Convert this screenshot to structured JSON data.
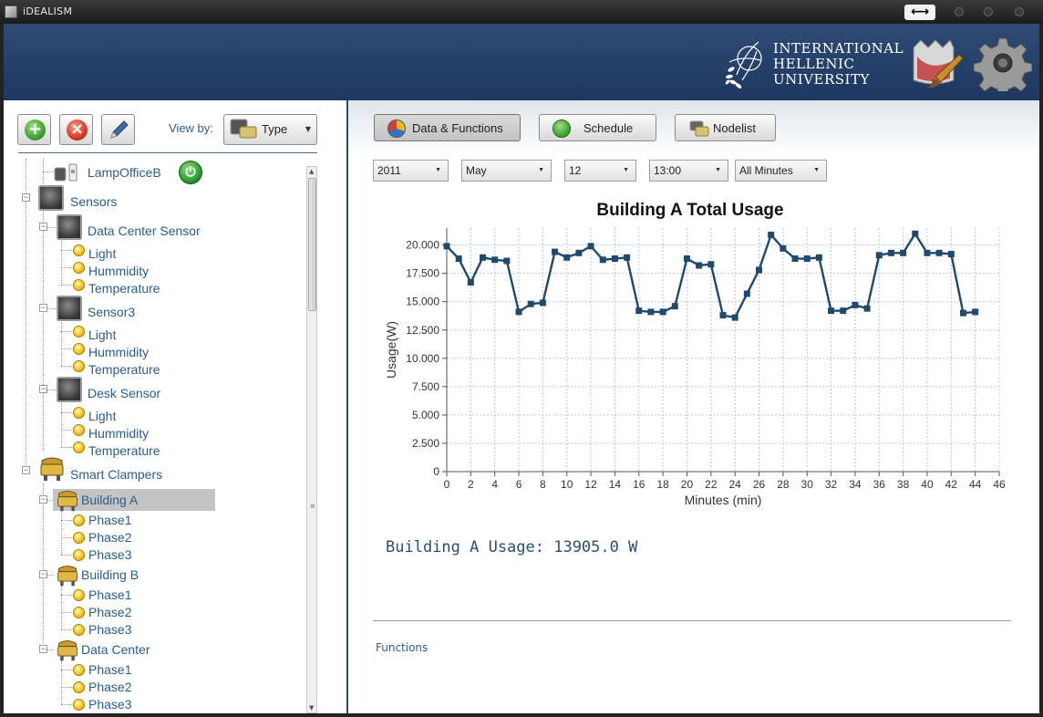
{
  "window": {
    "title": "iDEALISM"
  },
  "header": {
    "logo_lines": [
      "INTERNATIONAL",
      "HELLENIC",
      "UNIVERSITY"
    ]
  },
  "toolbar": {
    "viewby_label": "View by:",
    "viewby_value": "Type"
  },
  "tree": {
    "lamp": "LampOfficeB",
    "sensors_label": "Sensors",
    "sensors": [
      {
        "name": "Data Center Sensor",
        "children": [
          "Light",
          "Hummidity",
          "Temperature"
        ]
      },
      {
        "name": "Sensor3",
        "children": [
          "Light",
          "Hummidity",
          "Temperature"
        ]
      },
      {
        "name": "Desk Sensor",
        "children": [
          "Light",
          "Hummidity",
          "Temperature"
        ]
      }
    ],
    "clampers_label": "Smart Clampers",
    "clampers": [
      {
        "name": "Building A",
        "children": [
          "Phase1",
          "Phase2",
          "Phase3"
        ]
      },
      {
        "name": "Building B",
        "children": [
          "Phase1",
          "Phase2",
          "Phase3"
        ]
      },
      {
        "name": "Data Center",
        "children": [
          "Phase1",
          "Phase2",
          "Phase3"
        ]
      }
    ]
  },
  "tabs": {
    "data_functions": "Data & Functions",
    "schedule": "Schedule",
    "nodelist": "Nodelist"
  },
  "filters": {
    "year": "2011",
    "month": "May",
    "day": "12",
    "hour": "13:00",
    "minutes": "All Minutes"
  },
  "usage_text": "Building A Usage: 13905.0 W",
  "functions_label": "Functions",
  "chart_data": {
    "type": "line",
    "title": "Building A Total Usage",
    "xlabel": "Minutes (min)",
    "ylabel": "Usage(W)",
    "xlim": [
      0,
      46
    ],
    "ylim": [
      0,
      21500
    ],
    "xticks": [
      "0",
      "2",
      "4",
      "6",
      "8",
      "10",
      "12",
      "14",
      "16",
      "18",
      "20",
      "22",
      "24",
      "26",
      "28",
      "30",
      "32",
      "34",
      "36",
      "38",
      "40",
      "42",
      "44",
      "46"
    ],
    "yticks": [
      "0",
      "2.500",
      "5.000",
      "7.500",
      "10.000",
      "12.500",
      "15.000",
      "17.500",
      "20.000"
    ],
    "grid": true,
    "x": [
      0,
      1,
      2,
      3,
      4,
      5,
      6,
      7,
      8,
      9,
      10,
      11,
      12,
      13,
      14,
      15,
      16,
      17,
      18,
      19,
      20,
      21,
      22,
      23,
      24,
      25,
      26,
      27,
      28,
      29,
      30,
      31,
      32,
      33,
      34,
      35,
      36,
      37,
      38,
      39,
      40,
      41,
      42,
      43,
      44
    ],
    "values": [
      19900,
      18800,
      16700,
      18900,
      18700,
      18600,
      14100,
      14800,
      14900,
      19400,
      18900,
      19300,
      19900,
      18700,
      18800,
      18900,
      14200,
      14100,
      14100,
      14600,
      18800,
      18200,
      18300,
      13800,
      13600,
      15700,
      17800,
      20900,
      19700,
      18800,
      18800,
      18900,
      14200,
      14200,
      14700,
      14400,
      19100,
      19300,
      19300,
      21000,
      19300,
      19300,
      19200,
      14000,
      14100
    ],
    "color": "#1f4a6e"
  }
}
